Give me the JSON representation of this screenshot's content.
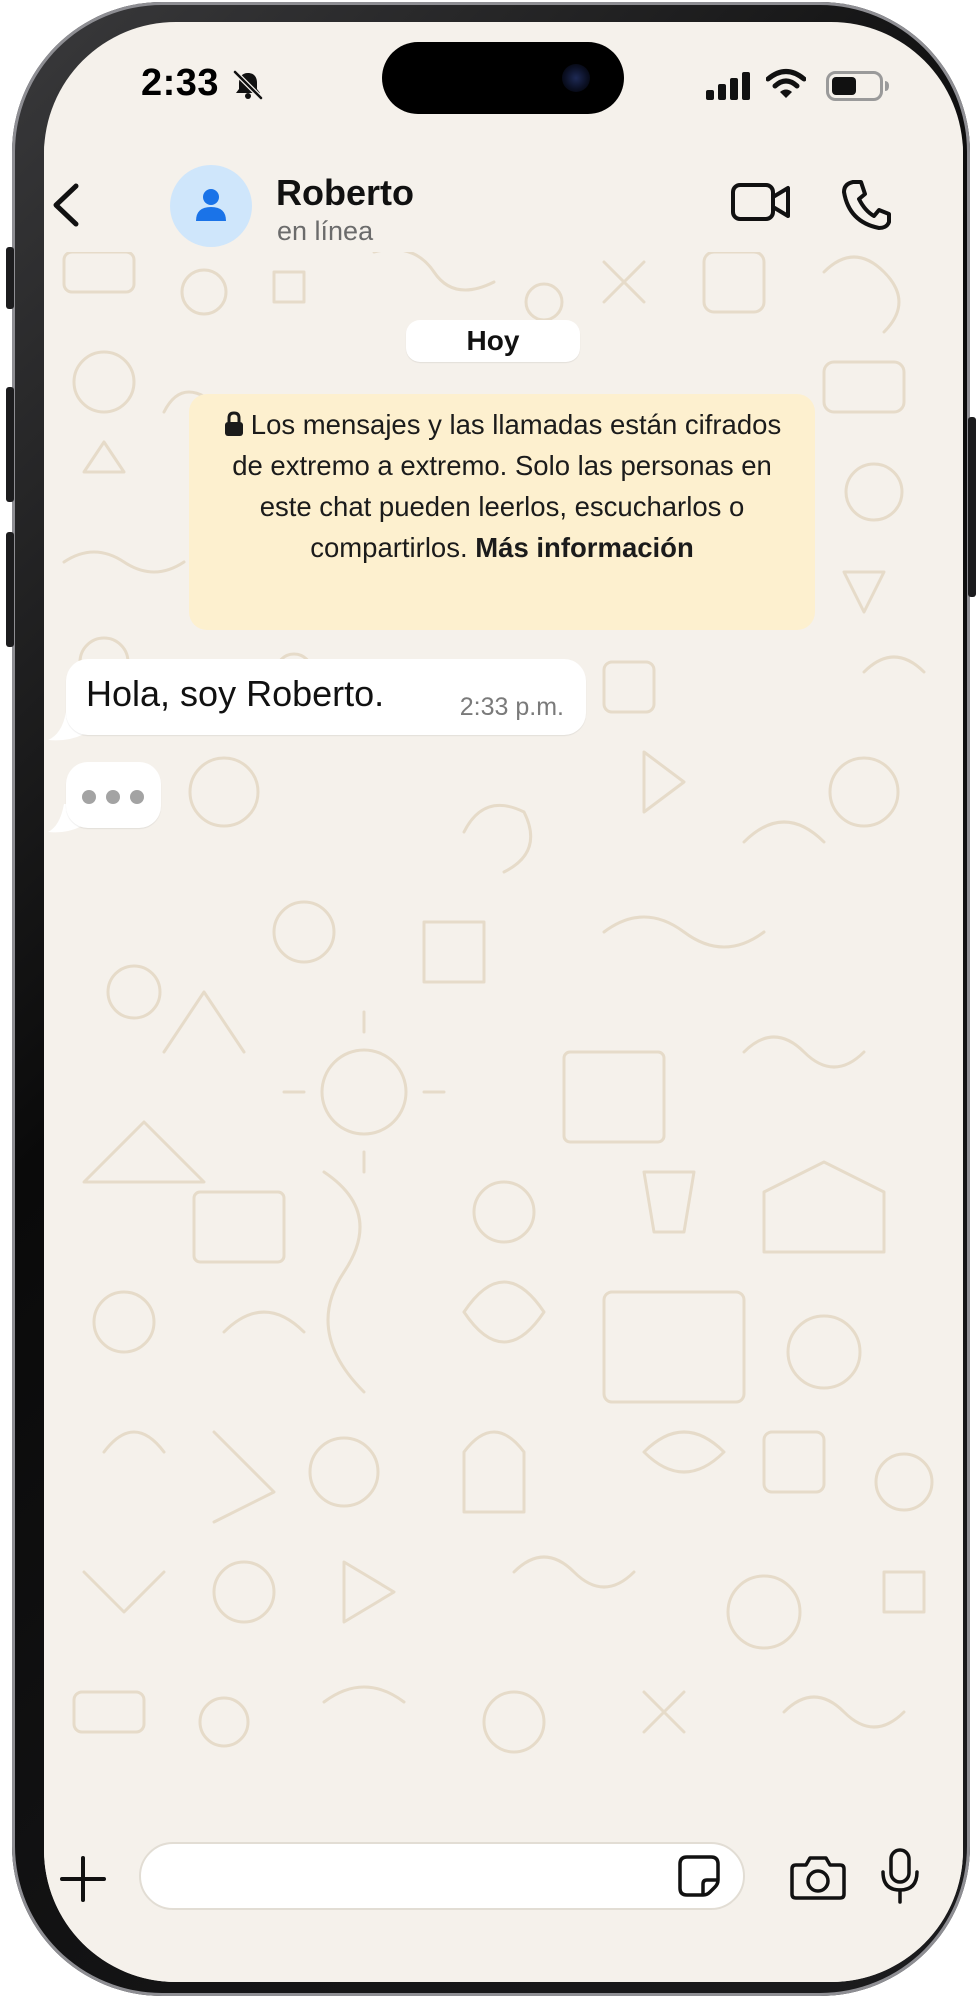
{
  "status_bar": {
    "time": "2:33",
    "icons": [
      "bell-slash-icon",
      "cellular-signal-icon",
      "wifi-icon",
      "battery-icon"
    ]
  },
  "header": {
    "contact_name": "Roberto",
    "contact_status": "en línea",
    "icons": [
      "back-chevron-icon",
      "person-icon",
      "video-camera-icon",
      "phone-icon"
    ]
  },
  "chat": {
    "date_label": "Hoy",
    "encryption_notice": {
      "text": "Los mensajes y las llamadas están cifrados de extremo a extremo. Solo las personas en este chat pueden leerlos, escucharlos o compartirlos.",
      "link": "Más información"
    },
    "messages": [
      {
        "direction": "incoming",
        "text": "Hola, soy Roberto.",
        "time": "2:33 p.m."
      }
    ],
    "typing_indicator": true
  },
  "composer": {
    "value": "",
    "placeholder": "",
    "icons": [
      "plus-icon",
      "sticker-icon",
      "camera-icon",
      "microphone-icon"
    ]
  },
  "colors": {
    "chat_background": "#f5f1eb",
    "incoming_bubble": "#ffffff",
    "notice_background": "#fdf0cf",
    "avatar_background": "#cfe6fb",
    "avatar_icon": "#1a73e8",
    "doodle_stroke": "#e6dbc9"
  }
}
